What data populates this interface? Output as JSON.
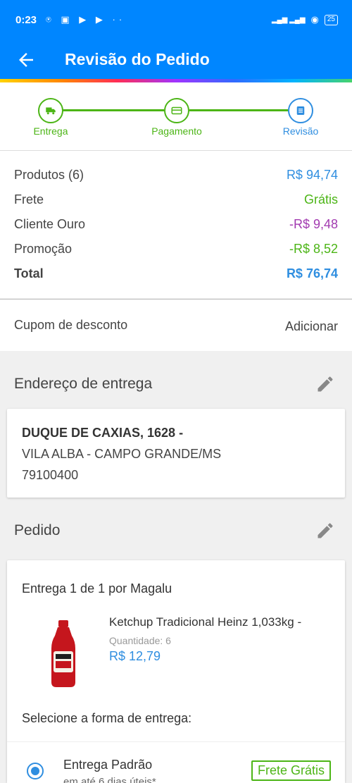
{
  "status_bar": {
    "time": "0:23",
    "notif_icons": "⍟ ▣ ▶ ▶ ··",
    "signal": "▂▄▆ ▂▄▆",
    "wifi": "◉",
    "battery": "25"
  },
  "appbar": {
    "title": "Revisão do Pedido"
  },
  "steps": [
    {
      "label": "Entrega",
      "icon": "truck-icon"
    },
    {
      "label": "Pagamento",
      "icon": "card-icon"
    },
    {
      "label": "Revisão",
      "icon": "document-icon"
    }
  ],
  "summary": {
    "produtos": {
      "label": "Produtos (6)",
      "value": "R$ 94,74",
      "color": "#2f8ee0"
    },
    "frete": {
      "label": "Frete",
      "value": "Grátis",
      "color": "#4cb516"
    },
    "cliente_ouro": {
      "label": "Cliente Ouro",
      "value": "-R$ 9,48",
      "color": "#a23ab0"
    },
    "promocao": {
      "label": "Promoção",
      "value": "-R$ 8,52",
      "color": "#4cb516"
    },
    "total": {
      "label": "Total",
      "value": "R$ 76,74",
      "color": "#2f8ee0"
    }
  },
  "coupon": {
    "label": "Cupom de desconto",
    "action": "Adicionar"
  },
  "address_section": {
    "title": "Endereço de entrega",
    "line1": "DUQUE DE CAXIAS, 1628 -",
    "line2": "VILA ALBA - CAMPO GRANDE/MS",
    "line3": "79100400"
  },
  "order_section": {
    "title": "Pedido",
    "delivery_title": "Entrega 1 de 1 por Magalu",
    "product": {
      "name": "Ketchup Tradicional Heinz 1,033kg -",
      "qty": "Quantidade:  6",
      "price": "R$ 12,79"
    },
    "choose_label": "Selecione a forma de entrega:",
    "option": {
      "name": "Entrega Padrão",
      "sub": "em até 6 dias úteis*",
      "badge": "Frete Grátis"
    }
  }
}
